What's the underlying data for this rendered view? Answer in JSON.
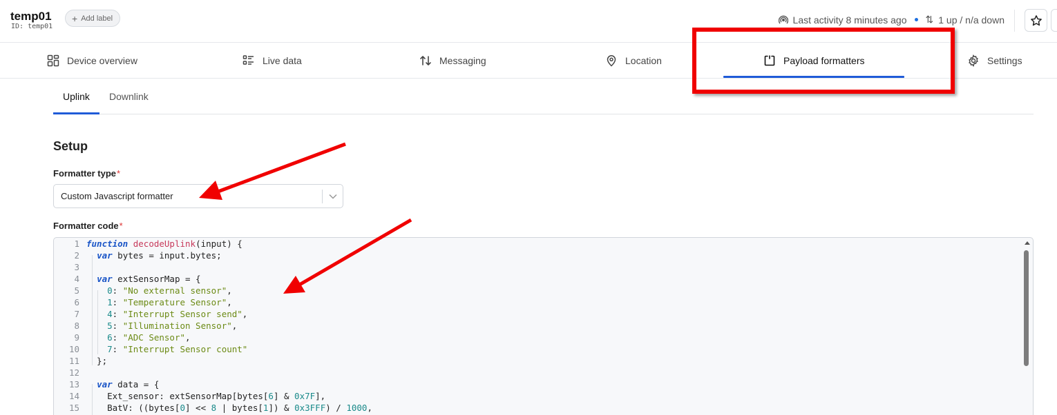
{
  "device": {
    "name": "temp01",
    "id_text": "ID: temp01",
    "add_label": "Add label"
  },
  "status": {
    "last_activity": "Last activity 8 minutes ago",
    "traffic": "1 up / n/a down"
  },
  "tabs": [
    {
      "label": "Device overview",
      "icon": "grid-icon"
    },
    {
      "label": "Live data",
      "icon": "list-icon"
    },
    {
      "label": "Messaging",
      "icon": "updown-arrows-icon"
    },
    {
      "label": "Location",
      "icon": "location-pin-icon"
    },
    {
      "label": "Payload formatters",
      "icon": "formatter-icon",
      "active": true
    },
    {
      "label": "Settings",
      "icon": "gear-icon"
    }
  ],
  "subtabs": [
    {
      "label": "Uplink",
      "active": true
    },
    {
      "label": "Downlink"
    }
  ],
  "setup": {
    "heading": "Setup",
    "formatter_type_label": "Formatter type",
    "formatter_type_value": "Custom Javascript formatter",
    "formatter_code_label": "Formatter code",
    "required_mark": "*"
  },
  "code_lines": [
    {
      "n": "1",
      "text": "function decodeUplink(input) {"
    },
    {
      "n": "2",
      "text": "  var bytes = input.bytes;"
    },
    {
      "n": "3",
      "text": ""
    },
    {
      "n": "4",
      "text": "  var extSensorMap = {"
    },
    {
      "n": "5",
      "text": "    0: \"No external sensor\","
    },
    {
      "n": "6",
      "text": "    1: \"Temperature Sensor\","
    },
    {
      "n": "7",
      "text": "    4: \"Interrupt Sensor send\","
    },
    {
      "n": "8",
      "text": "    5: \"Illumination Sensor\","
    },
    {
      "n": "9",
      "text": "    6: \"ADC Sensor\","
    },
    {
      "n": "10",
      "text": "    7: \"Interrupt Sensor count\""
    },
    {
      "n": "11",
      "text": "  };"
    },
    {
      "n": "12",
      "text": ""
    },
    {
      "n": "13",
      "text": "  var data = {"
    },
    {
      "n": "14",
      "text": "    Ext_sensor: extSensorMap[bytes[6] & 0x7F],"
    },
    {
      "n": "15",
      "text": "    BatV: ((bytes[0] << 8 | bytes[1]) & 0x3FFF) / 1000,"
    }
  ],
  "colors": {
    "accent": "#1f5bd8",
    "annotation_red": "#f00000",
    "keyword": "#1a55c7",
    "function_name": "#c7385a",
    "string": "#6b8a14",
    "number": "#1a8a8a"
  }
}
